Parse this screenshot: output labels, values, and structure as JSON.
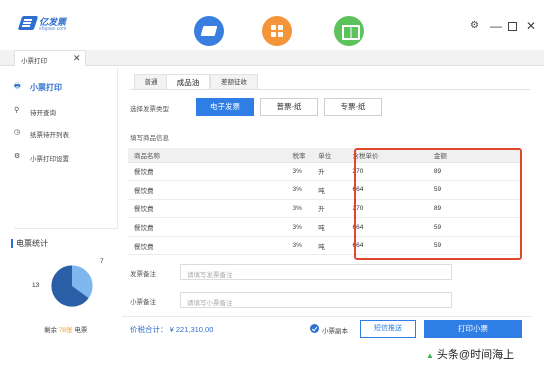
{
  "app": {
    "logo_name": "亿发票",
    "logo_sub": "efapiao.com",
    "colors": {
      "accent": "#2f7ee5",
      "highlight": "#e1472c",
      "orange": "#f5953a",
      "green": "#5cc25b"
    },
    "top_icons": [
      "invoice-icon",
      "apps-grid-icon",
      "book-icon"
    ]
  },
  "window": {
    "min": "—",
    "close": "✕"
  },
  "doc_tab": {
    "label": "小票打印",
    "close": "✕"
  },
  "sidebar": {
    "items": [
      {
        "icon": "printer-icon",
        "label": "小票打印",
        "active": true
      },
      {
        "icon": "search-icon",
        "label": "待开查询"
      },
      {
        "icon": "clock-icon",
        "label": "纸票待开列表"
      },
      {
        "icon": "gear-icon",
        "label": "小票打印设置"
      }
    ],
    "stats": {
      "title": "电票统计",
      "pie_major": 13,
      "pie_minor": 7,
      "remaining_prefix": "剩余",
      "remaining_value": "78张",
      "remaining_suffix": "电票"
    }
  },
  "main": {
    "type_tabs": [
      "普通",
      "成品油",
      "差额征收"
    ],
    "active_type_tab": 1,
    "invoice_type_label": "选择发票类型",
    "invoice_types": [
      "电子发票",
      "普票-纸",
      "专票-纸"
    ],
    "selected_invoice_type": 0,
    "goods_label": "填写商品信息",
    "table": {
      "headers": [
        "商品名称",
        "税率",
        "单位",
        "含税单价",
        "金额"
      ],
      "rows": [
        [
          "餐饮费",
          "3%",
          "升",
          "270",
          "89"
        ],
        [
          "餐饮费",
          "3%",
          "吨",
          "664",
          "59"
        ],
        [
          "餐饮费",
          "3%",
          "升",
          "270",
          "89"
        ],
        [
          "餐饮费",
          "3%",
          "吨",
          "664",
          "59"
        ],
        [
          "餐饮费",
          "3%",
          "吨",
          "664",
          "59"
        ]
      ]
    },
    "invoice_note": {
      "label": "发票备注",
      "placeholder": "请填写发票备注"
    },
    "receipt_note": {
      "label": "小票备注",
      "placeholder": "请填写小票备注"
    }
  },
  "footer": {
    "total_label": "价税合计：",
    "total_value": "¥ 221,310.00",
    "copy_label": "小票副本",
    "sms_button": "短信推送",
    "print_button": "打印小票"
  },
  "watermark": {
    "prefix": "头条",
    "text": "@时间海上"
  }
}
